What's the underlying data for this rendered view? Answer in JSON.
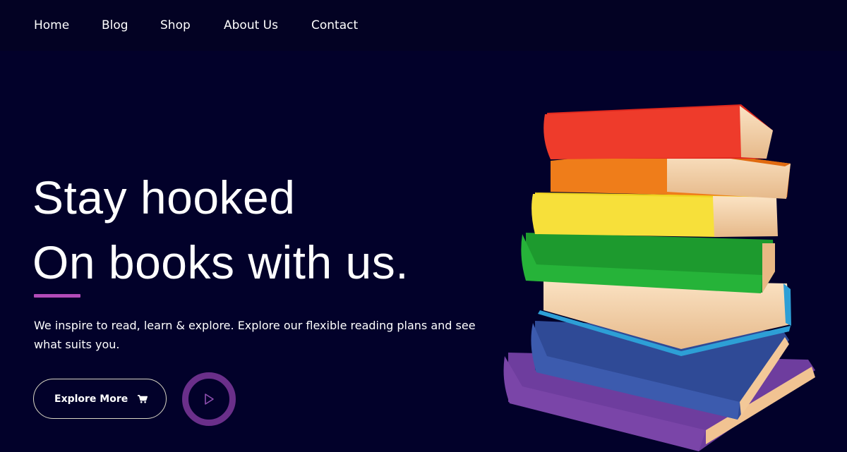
{
  "nav": {
    "items": [
      {
        "label": "Home"
      },
      {
        "label": "Blog"
      },
      {
        "label": "Shop"
      },
      {
        "label": "About Us"
      },
      {
        "label": "Contact"
      }
    ]
  },
  "hero": {
    "title_line1": "Stay hooked",
    "title_line2": "On books with us.",
    "description": "We inspire to read, learn & explore. Explore our flexible reading plans and see what suits you.",
    "explore_label": "Explore More",
    "explore_icon": "cart-icon",
    "play_icon": "play-icon"
  },
  "colors": {
    "background": "#02012a",
    "accent": "#b24bb8",
    "play_ring": "#6a2f8a"
  }
}
